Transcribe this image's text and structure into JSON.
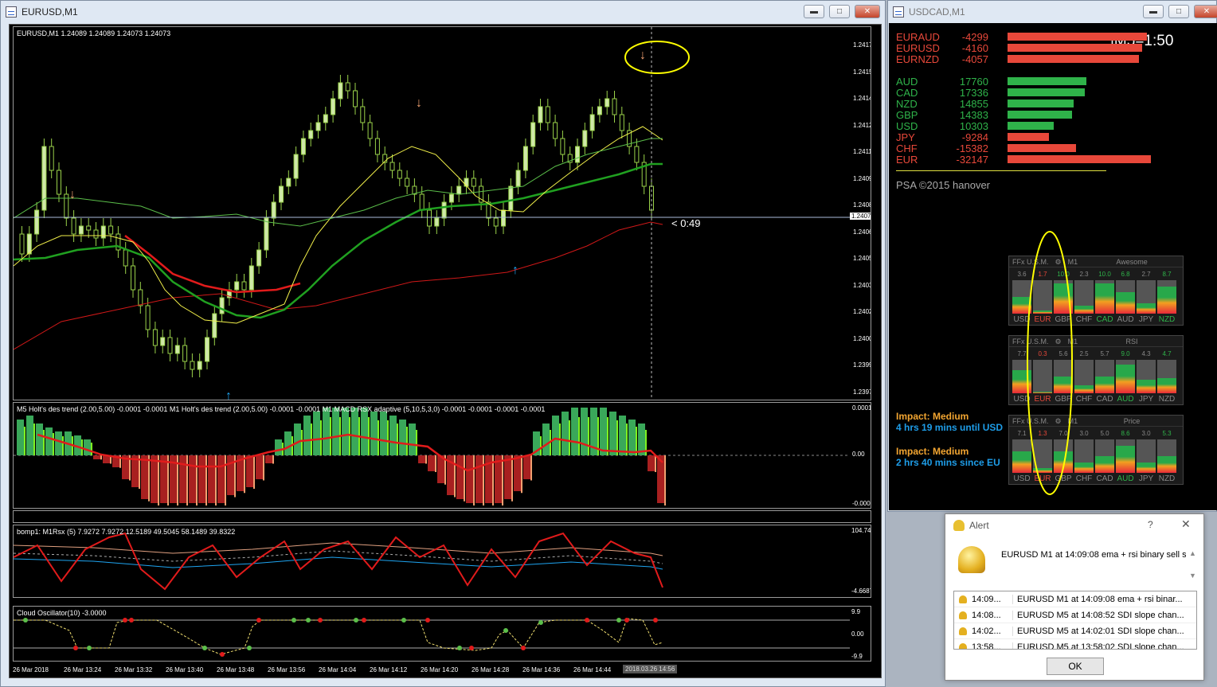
{
  "left_window": {
    "title": "EURUSD,M1",
    "chart_header": "EURUSD,M1  1.24089 1.24089 1.24073 1.24073",
    "price_labels": [
      "1.24170",
      "1.24155",
      "1.24140",
      "1.24125",
      "1.24110",
      "1.24095",
      "1.24080",
      "1.24065",
      "1.24050",
      "1.24035",
      "1.24020",
      "1.24005",
      "1.23990",
      "1.23975"
    ],
    "current_price": "1.24073",
    "countdown": "< 0:49",
    "indicator1_header": "M5 Holt's des trend (2.00,5.00) -0.0001 -0.0001  M1 Holt's des trend (2.00,5.00) -0.0001 -0.0001  M1 MACD RSX adaptive (5,10,5,3,0) -0.0001 -0.0001 -0.0001 -0.0001",
    "indicator1_scale": [
      "0.0001",
      "0.00",
      "-0.0001"
    ],
    "indicator2_header": "bomp1: M1Rsx (5) 7.9272 7.9272 12.5189 49.5045 58.1489 39.8322",
    "indicator2_scale": [
      "104.7416",
      "-4.6687"
    ],
    "indicator3_header": "Cloud Oscillator(10) -3.0000",
    "indicator3_scale": [
      "9.9",
      "0.00",
      "-9.9"
    ],
    "time_labels": [
      "26 Mar 2018",
      "26 Mar 13:24",
      "26 Mar 13:32",
      "26 Mar 13:40",
      "26 Mar 13:48",
      "26 Mar 13:56",
      "26 Mar 14:04",
      "26 Mar 14:12",
      "26 Mar 14:20",
      "26 Mar 14:28",
      "26 Mar 14:36",
      "26 Mar 14:44"
    ],
    "time_cursor": "2018.03.26 14:56"
  },
  "right_window": {
    "title": "USDCAD,M1",
    "m5_label": "|M5=1:50",
    "pairs": [
      {
        "name": "EURAUD",
        "value": "-4299"
      },
      {
        "name": "EURUSD",
        "value": "-4160"
      },
      {
        "name": "EURNZD",
        "value": "-4057"
      }
    ],
    "currencies": [
      {
        "name": "AUD",
        "value": "17760",
        "color": "#2fb34a"
      },
      {
        "name": "CAD",
        "value": "17336",
        "color": "#2fb34a"
      },
      {
        "name": "NZD",
        "value": "14855",
        "color": "#2fb34a"
      },
      {
        "name": "GBP",
        "value": "14383",
        "color": "#2fb34a"
      },
      {
        "name": "USD",
        "value": "10303",
        "color": "#2fb34a"
      },
      {
        "name": "JPY",
        "value": "-9284",
        "color": "#e8483a"
      },
      {
        "name": "CHF",
        "value": "-15382",
        "color": "#e8483a"
      },
      {
        "name": "EUR",
        "value": "-32147",
        "color": "#e8483a"
      }
    ],
    "copyright": "PSA ©2015 hanover",
    "panels": [
      {
        "brand": "FFx U.S.M.",
        "tf": "M1",
        "name": "Awesome",
        "values": [
          "3.6",
          "1.7",
          "10.0",
          "2.3",
          "10.0",
          "6.8",
          "2.7",
          "8.7"
        ]
      },
      {
        "brand": "FFx U.S.M.",
        "tf": "M1",
        "name": "RSI",
        "values": [
          "7.7",
          "0.3",
          "5.6",
          "2.5",
          "5.7",
          "9.0",
          "4.3",
          "4.7"
        ]
      },
      {
        "brand": "FFx U.S.M.",
        "tf": "M1",
        "name": "Price",
        "values": [
          "7.1",
          "1.3",
          "7.0",
          "3.0",
          "5.0",
          "8.6",
          "3.0",
          "5.3"
        ]
      }
    ],
    "panel_currencies": [
      "USD",
      "EUR",
      "GBP",
      "CHF",
      "CAD",
      "AUD",
      "JPY",
      "NZD"
    ],
    "impact1_title": "Impact: Medium",
    "impact1_text": "4 hrs 19 mins until USD",
    "impact2_title": "Impact: Medium",
    "impact2_text": "2 hrs 40 mins since EU"
  },
  "alert": {
    "title": "Alert",
    "help": "?",
    "message": "EURUSD M1 at 14:09:08 ema + rsi binary sell si",
    "rows": [
      {
        "time": "14:09...",
        "text": "EURUSD M1 at 14:09:08 ema + rsi binar..."
      },
      {
        "time": "14:08...",
        "text": "EURUSD M5 at 14:08:52 SDI slope chan..."
      },
      {
        "time": "14:02...",
        "text": "EURUSD M5 at 14:02:01 SDI slope chan..."
      },
      {
        "time": "13:58...",
        "text": "EURUSD M5 at 13:58:02 SDI slope chan..."
      }
    ],
    "ok": "OK"
  },
  "colors": {
    "accent_red": "#e8483a",
    "accent_green": "#2fb34a",
    "impact": "#f2a531",
    "impact_text": "#1e9de8",
    "annotation": "#ffff00"
  }
}
